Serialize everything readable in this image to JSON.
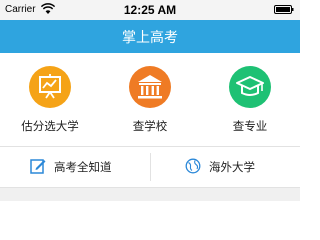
{
  "status_bar": {
    "carrier": "Carrier",
    "time": "12:25 AM"
  },
  "header": {
    "title": "掌上高考"
  },
  "grid": {
    "items": [
      {
        "label": "估分选大学",
        "icon": "chalkboard-chart-icon",
        "color": "#f5a317"
      },
      {
        "label": "查学校",
        "icon": "university-building-icon",
        "color": "#ef7b24"
      },
      {
        "label": "查专业",
        "icon": "graduation-cap-icon",
        "color": "#1ec174"
      }
    ]
  },
  "quick_links": {
    "items": [
      {
        "label": "高考全知道",
        "icon": "edit-pencil-icon",
        "color": "#2b88d8"
      },
      {
        "label": "海外大学",
        "icon": "globe-icon",
        "color": "#2b88d8"
      }
    ]
  },
  "colors": {
    "nav_bar": "#2fa4df"
  }
}
